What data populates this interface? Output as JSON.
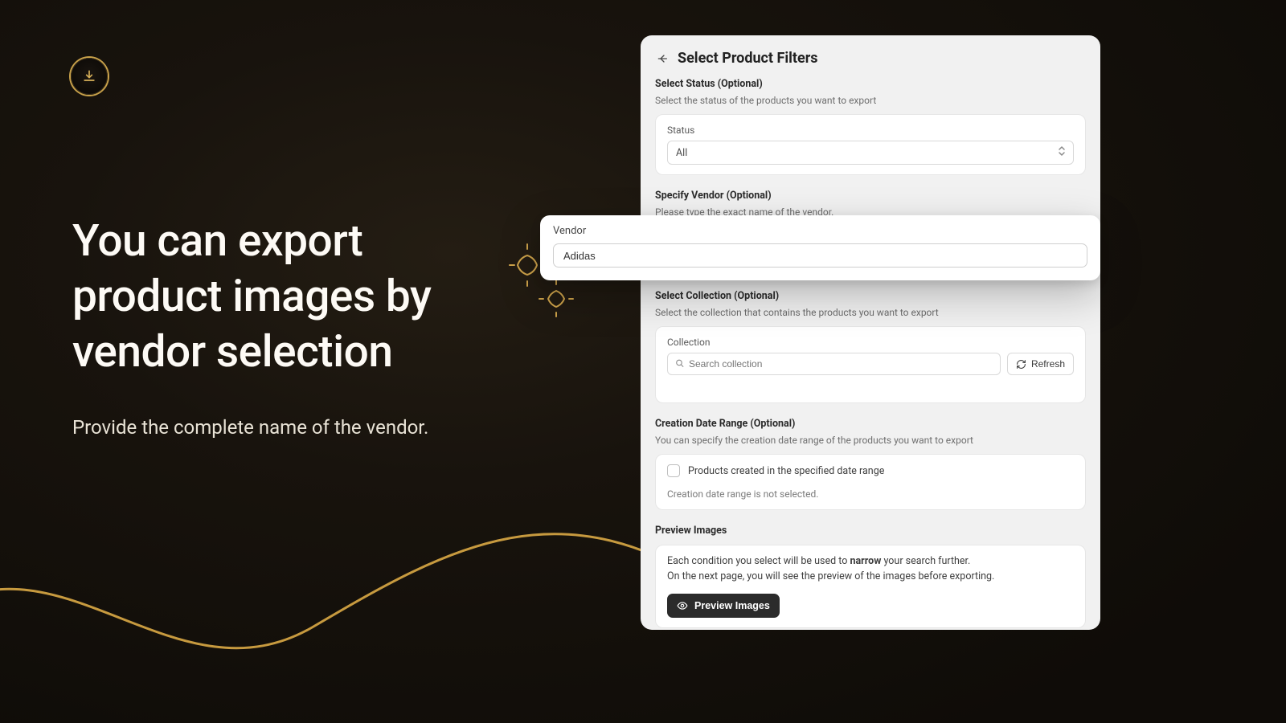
{
  "hero": {
    "title": "You can export product images by vendor selection",
    "subtitle": "Provide the complete name of the vendor."
  },
  "panel": {
    "back_icon": "arrow-left",
    "title": "Select Product Filters",
    "status": {
      "label": "Select Status (Optional)",
      "desc": "Select the status of the products you want to export",
      "field_label": "Status",
      "value": "All"
    },
    "vendor": {
      "label": "Specify Vendor (Optional)",
      "desc": "Please type the exact name of the vendor.",
      "field_label": "Vendor",
      "value": "Adidas"
    },
    "collection": {
      "label": "Select Collection (Optional)",
      "desc": "Select the collection that contains the products you want to export",
      "field_label": "Collection",
      "search_placeholder": "Search collection",
      "refresh_label": "Refresh"
    },
    "date_range": {
      "label": "Creation Date Range (Optional)",
      "desc": "You can specify the creation date range of the products you want to export",
      "checkbox_label": "Products created in the specified date range",
      "status_text": "Creation date range is not selected."
    },
    "preview": {
      "label": "Preview Images",
      "line1_prefix": "Each condition you select will be used to ",
      "line1_strong": "narrow",
      "line1_suffix": " your search further.",
      "line2": "On the next page, you will see the preview of the images before exporting.",
      "button_label": "Preview Images"
    }
  }
}
